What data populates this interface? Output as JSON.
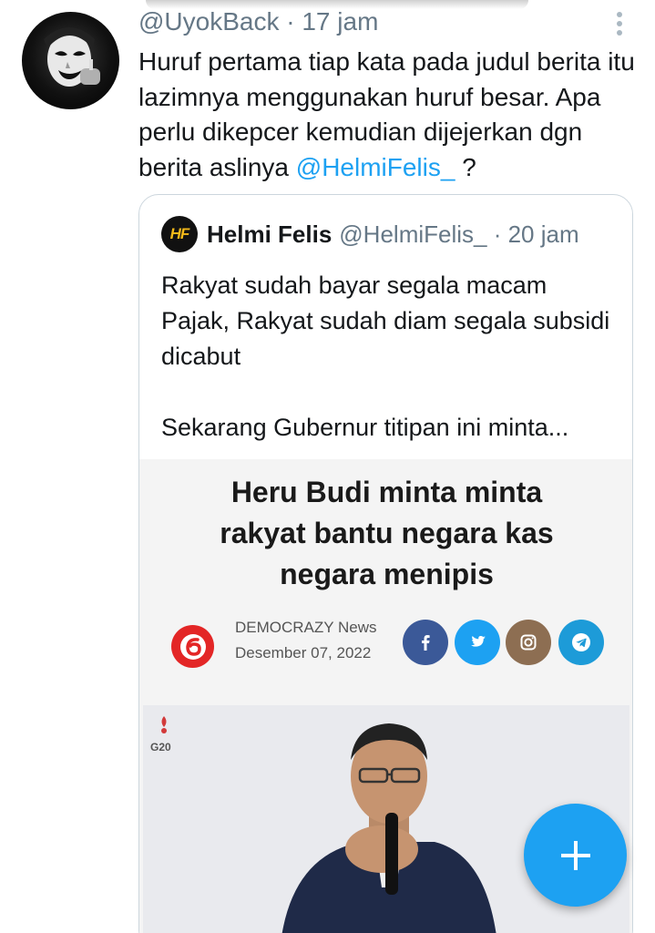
{
  "tweet": {
    "handle": "@UyokBack",
    "separator": "·",
    "time": "17 jam",
    "text_plain": "Huruf pertama tiap kata pada judul berita itu lazimnya menggunakan huruf besar. Apa perlu dikepcer kemudian dijejerkan dgn berita aslinya ",
    "mention": "@HelmiFelis_",
    "text_tail": " ?"
  },
  "quoted": {
    "avatar_initials": "HF",
    "name": "Helmi Felis",
    "handle": "@HelmiFelis_",
    "meta": "@HelmiFelis_ · 20 jam",
    "time": "20 jam",
    "text": "Rakyat sudah bayar segala macam Pajak, Rakyat sudah diam segala subsidi dicabut\n\nSekarang Gubernur titipan ini minta..."
  },
  "card": {
    "headline_lines": [
      "Heru Budi minta minta",
      "rakyat bantu negara kas",
      "negara menipis"
    ],
    "source_name": "DEMOCRAZY News",
    "source_date": "Desember 07, 2022",
    "share_icons": [
      "facebook-icon",
      "twitter-icon",
      "instagram-icon",
      "telegram-icon"
    ],
    "photo_badge": "G20"
  },
  "icons": {
    "more": "more-vertical-icon",
    "compose": "plus-icon"
  },
  "colors": {
    "accent": "#1da1f2",
    "secondary_text": "#657786",
    "border": "#ccd6dd",
    "brand_red": "#e32626"
  }
}
